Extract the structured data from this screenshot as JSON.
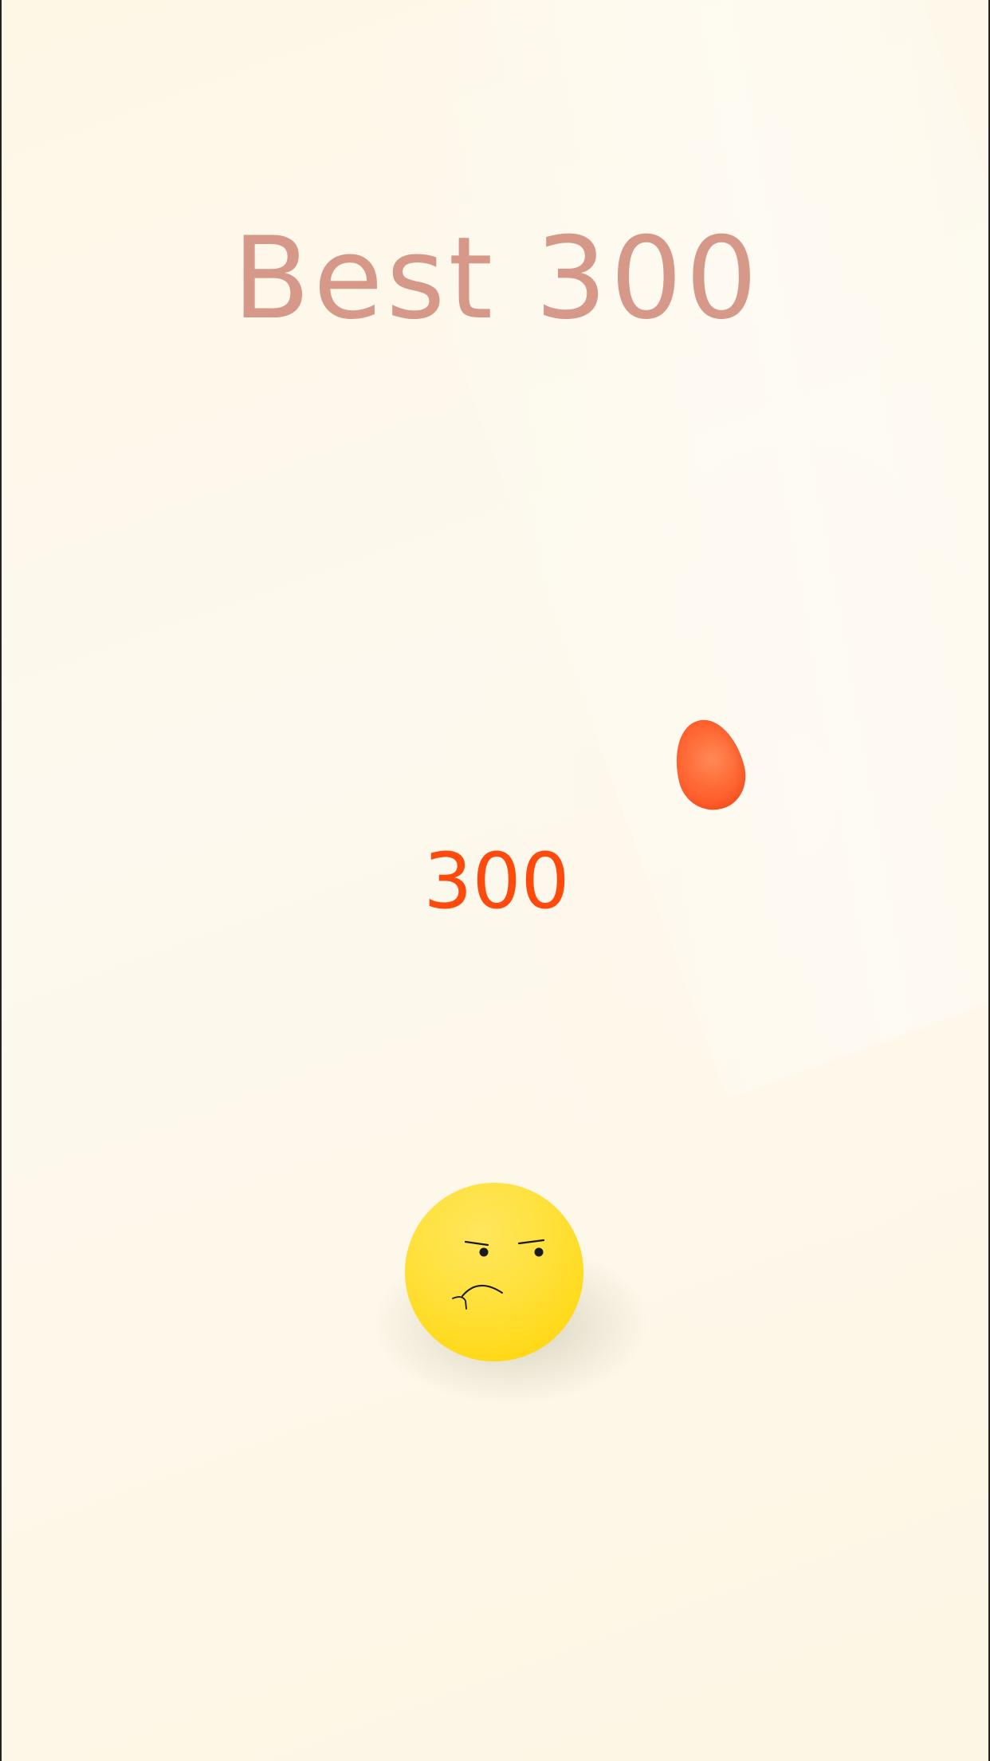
{
  "hud": {
    "best_label": "Best 300",
    "score": "300"
  },
  "player": {
    "icon": "grumpy-face-ball",
    "color": "#ffdd22",
    "expression": "frown"
  },
  "obstacle": {
    "icon": "orange-drop",
    "color": "#ff5a24"
  },
  "colors": {
    "background": "#fdf8e8",
    "best_text": "#d69888",
    "score_text": "#ff4a0e"
  }
}
